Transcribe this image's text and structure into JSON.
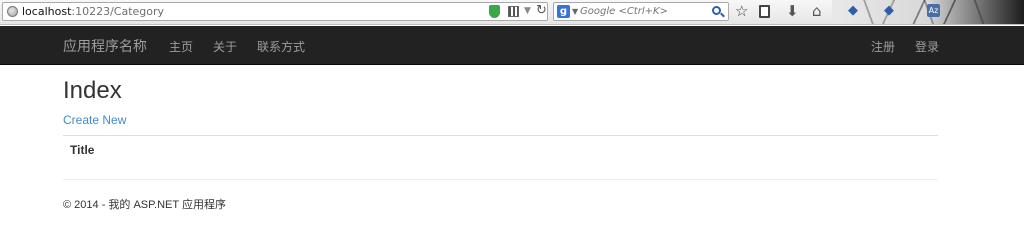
{
  "browser": {
    "url_host": "localhost",
    "url_rest": ":10223/Category",
    "search_engine_icon": "g",
    "search_placeholder": "Google <Ctrl+K>",
    "translate_icon": "Az",
    "icons": [
      "globe-icon",
      "shield-icon",
      "grid-icon",
      "dropdown-icon",
      "reload-icon",
      "google-icon",
      "magnifier-icon",
      "star-icon",
      "clipboard-icon",
      "download-icon",
      "home-icon",
      "translate-icon"
    ]
  },
  "navbar": {
    "brand": "应用程序名称",
    "links": [
      "主页",
      "关于",
      "联系方式"
    ],
    "right_links": [
      "注册",
      "登录"
    ],
    "background": "#222222",
    "link_color": "#9d9d9d"
  },
  "main": {
    "title": "Index",
    "create_link": "Create New",
    "link_color": "#428bca",
    "table": {
      "columns": [
        "Title"
      ],
      "rows": []
    }
  },
  "footer": {
    "text": "© 2014 - 我的 ASP.NET 应用程序"
  }
}
